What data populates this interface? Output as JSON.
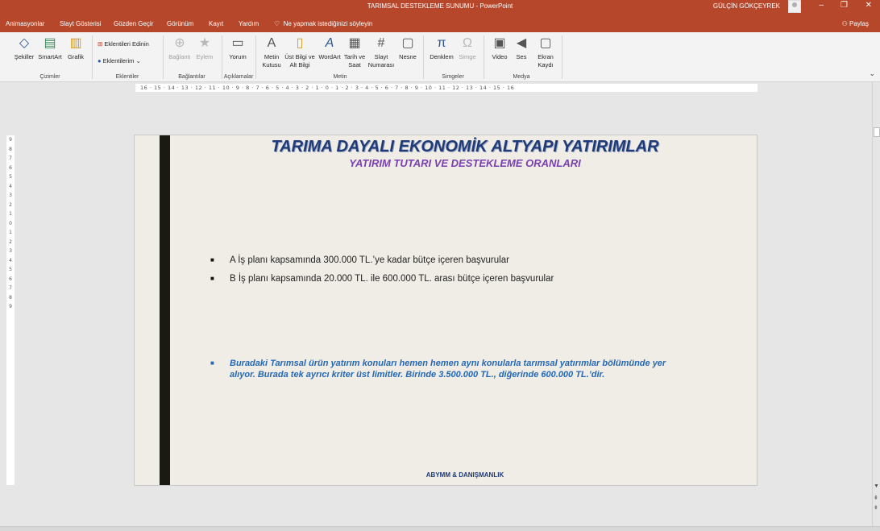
{
  "window": {
    "title": "TARIMSAL DESTEKLEME SUNUMU  -  PowerPoint",
    "user": "GÜLÇİN GÖKÇEYREK",
    "minimize": "–",
    "restore": "❐",
    "close": "✕"
  },
  "menu": {
    "tabs": [
      "Animasyonlar",
      "Slayt Gösterisi",
      "Gözden Geçir",
      "Görünüm",
      "Kayıt",
      "Yardım"
    ],
    "tell_me": "Ne yapmak istediğinizi söyleyin",
    "share": "Paylaş"
  },
  "ribbon": {
    "buttons": [
      {
        "label": "Şekiller",
        "icon": "shapes-icon"
      },
      {
        "label": "SmartArt",
        "icon": "smartart-icon"
      },
      {
        "label": "Grafik",
        "icon": "chart-icon"
      },
      {
        "label": "Eklentileri Edinin",
        "icon": "store-icon"
      },
      {
        "label": "Eklentilerim",
        "icon": "addins-icon"
      },
      {
        "label": "Bağlantı",
        "icon": "link-icon"
      },
      {
        "label": "Eylem",
        "icon": "action-icon"
      },
      {
        "label": "Yorum",
        "icon": "comment-icon"
      },
      {
        "label": "Metin Kutusu",
        "icon": "textbox-icon"
      },
      {
        "label": "Üst Bilgi ve Alt Bilgi",
        "icon": "header-footer-icon"
      },
      {
        "label": "WordArt",
        "icon": "wordart-icon"
      },
      {
        "label": "Tarih ve Saat",
        "icon": "datetime-icon"
      },
      {
        "label": "Slayt Numarası",
        "icon": "slide-number-icon"
      },
      {
        "label": "Nesne",
        "icon": "object-icon"
      },
      {
        "label": "Denklem",
        "icon": "equation-icon"
      },
      {
        "label": "Simge",
        "icon": "symbol-icon"
      },
      {
        "label": "Video",
        "icon": "video-icon"
      },
      {
        "label": "Ses",
        "icon": "audio-icon"
      },
      {
        "label": "Ekran Kaydı",
        "icon": "screen-recording-icon"
      }
    ],
    "groups": [
      "Çizimler",
      "Eklentiler",
      "Bağlantılar",
      "Açıklamalar",
      "Metin",
      "Simgeler",
      "Medya"
    ]
  },
  "ruler": {
    "horizontal": "16 · 15 · 14 · 13 · 12 · 11 · 10 · 9 · 8 · 7 · 6 · 5 · 4 · 3 · 2 · 1 · 0 · 1 · 2 · 3 · 4 · 5 · 6 · 7 · 8 · 9 · 10 · 11 · 12 · 13 · 14 · 15 · 16",
    "vertical": [
      "9",
      "8",
      "7",
      "6",
      "5",
      "4",
      "3",
      "2",
      "1",
      "0",
      "1",
      "2",
      "3",
      "4",
      "5",
      "6",
      "7",
      "8",
      "9"
    ]
  },
  "slide": {
    "title": "TARIMA DAYALI EKONOMİK ALTYAPI YATIRIMLAR",
    "subtitle": "YATIRIM TUTARI VE DESTEKLEME ORANLARI",
    "bullets": [
      "A İş planı kapsamında 300.000 TL.’ye kadar bütçe içeren başvurular",
      "B İş planı kapsamında 20.000 TL. ile 600.000 TL. arası bütçe içeren başvurular"
    ],
    "note": "Buradaki Tarımsal ürün yatırım konuları hemen hemen aynı konularla tarımsal yatırımlar bölümünde yer alıyor. Burada tek ayrıcı kriter üst limitler. Birinde 3.500.000 TL., diğerinde 600.000 TL.’dir.",
    "footer": "ABYMM & DANIŞMANLIK"
  },
  "colors": {
    "accent": "#b7472a",
    "title": "#1f3a78",
    "subtitle": "#7a3fb0",
    "note": "#2468b4",
    "slide_bg": "#f0ede7"
  }
}
